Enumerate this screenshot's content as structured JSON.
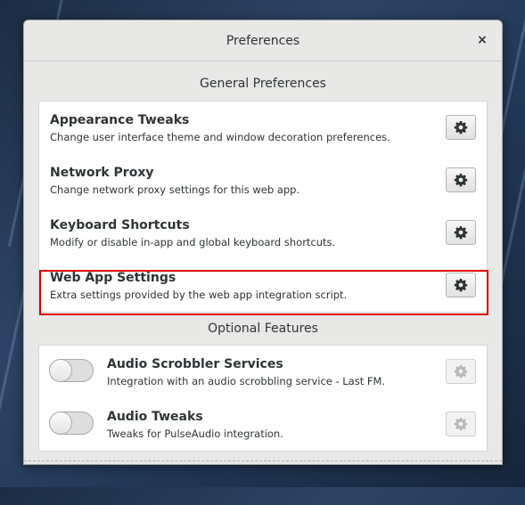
{
  "window": {
    "title": "Preferences",
    "close_label": "×"
  },
  "general": {
    "heading": "General Preferences",
    "rows": [
      {
        "name": "Appearance Tweaks",
        "desc": "Change user interface theme and window decoration preferences."
      },
      {
        "name": "Network Proxy",
        "desc": "Change network proxy settings for this web app."
      },
      {
        "name": "Keyboard Shortcuts",
        "desc": "Modify or disable in-app and global keyboard shortcuts."
      },
      {
        "name": "Web App Settings",
        "desc": "Extra settings provided by the web app integration script."
      }
    ]
  },
  "optional": {
    "heading": "Optional Features",
    "rows": [
      {
        "name": "Audio Scrobbler Services",
        "desc": "Integration with an audio scrobbling service - Last FM.",
        "enabled": false
      },
      {
        "name": "Audio Tweaks",
        "desc": "Tweaks for PulseAudio integration.",
        "enabled": false
      }
    ]
  },
  "colors": {
    "highlight": "#e00000",
    "text": "#2e3436"
  }
}
